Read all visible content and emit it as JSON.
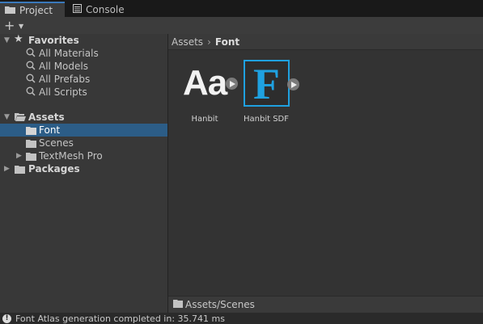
{
  "tabs": [
    {
      "label": "Project",
      "icon": "folder-icon",
      "active": true
    },
    {
      "label": "Console",
      "icon": "console-icon",
      "active": false
    }
  ],
  "toolbar": {
    "add_label": "+"
  },
  "tree": {
    "favorites": {
      "label": "Favorites",
      "items": [
        "All Materials",
        "All Models",
        "All Prefabs",
        "All Scripts"
      ]
    },
    "assets": {
      "label": "Assets",
      "children": [
        "Font",
        "Scenes",
        "TextMesh Pro"
      ],
      "selected": "Font"
    },
    "packages": {
      "label": "Packages"
    }
  },
  "breadcrumb": {
    "root": "Assets",
    "current": "Font"
  },
  "assets_grid": [
    {
      "name": "Hanbit",
      "preview_text": "Aa"
    },
    {
      "name": "Hanbit SDF",
      "preview_text": "F"
    }
  ],
  "footer_path": "Assets/Scenes",
  "status_message": "Font Atlas generation completed in: 35.741 ms",
  "colors": {
    "accent": "#1fa1e0",
    "selection": "#2c5d87",
    "tab_highlight": "#3a79bb"
  }
}
